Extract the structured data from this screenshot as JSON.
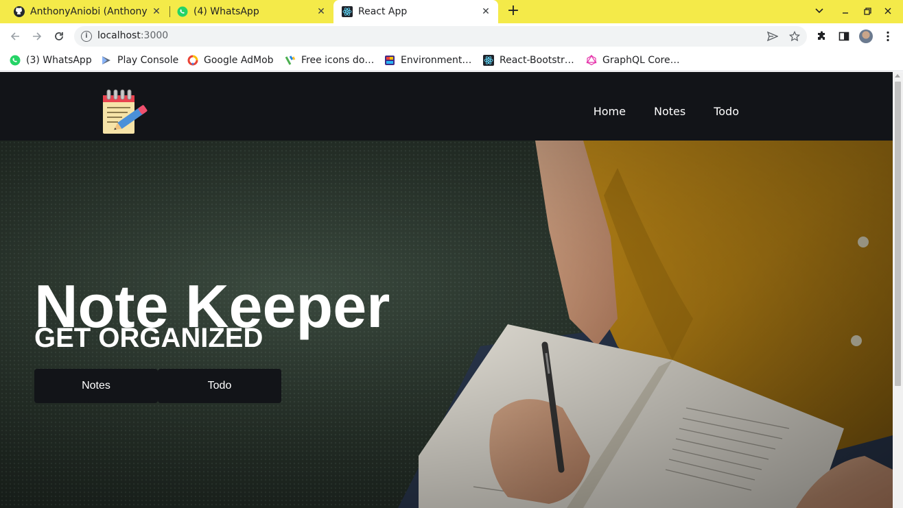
{
  "browser": {
    "tabs": [
      {
        "title": "AnthonyAniobi (Anthony A",
        "icon": "github-icon"
      },
      {
        "title": "(4) WhatsApp",
        "icon": "whatsapp-icon"
      },
      {
        "title": "React App",
        "icon": "react-icon",
        "active": true
      }
    ],
    "address": {
      "host": "localhost",
      "port": ":3000"
    },
    "bookmarks": [
      {
        "label": "(3) WhatsApp",
        "icon": "whatsapp-icon"
      },
      {
        "label": "Play Console",
        "icon": "play-console-icon"
      },
      {
        "label": "Google AdMob",
        "icon": "admob-icon"
      },
      {
        "label": "Free icons do…",
        "icon": "flaticon-icon"
      },
      {
        "label": "Environment…",
        "icon": "environment-icon"
      },
      {
        "label": "React-Bootstr…",
        "icon": "react-icon"
      },
      {
        "label": "GraphQL Core…",
        "icon": "graphql-icon"
      }
    ],
    "accent": "#f4ea49"
  },
  "navbar": {
    "logo": "notepad-pencil-icon",
    "links": [
      "Home",
      "Notes",
      "Todo"
    ]
  },
  "hero": {
    "title": "Note Keeper",
    "subtitle": "GET ORGANIZED",
    "buttons": [
      "Notes",
      "Todo"
    ]
  }
}
